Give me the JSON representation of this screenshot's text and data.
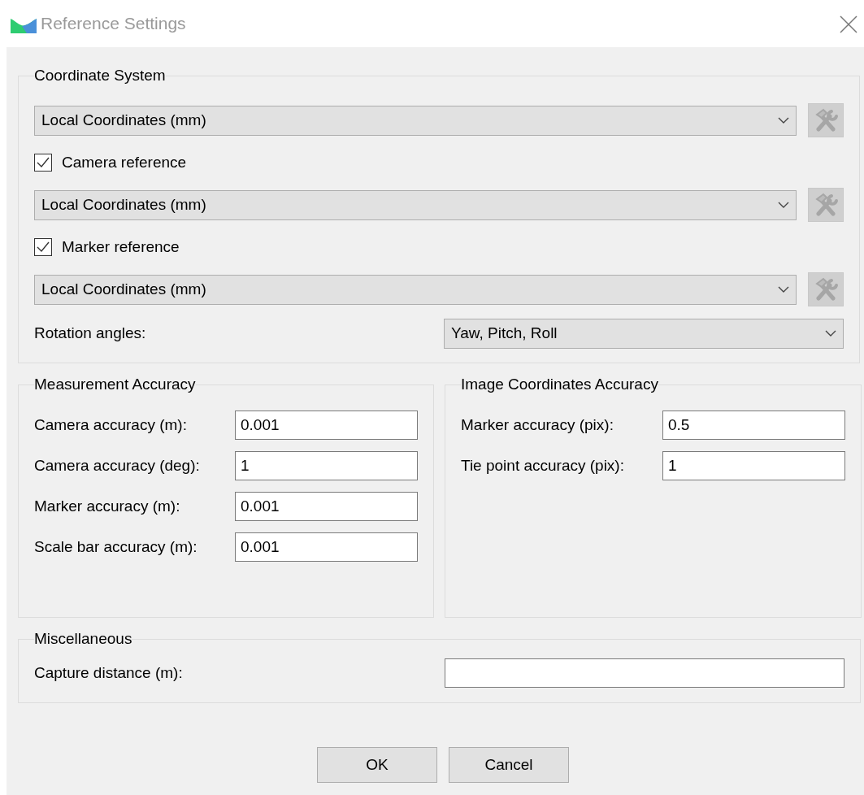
{
  "window": {
    "title": "Reference Settings"
  },
  "coordinate_system": {
    "title": "Coordinate System",
    "crs": "Local Coordinates (mm)",
    "camera_reference": {
      "label": "Camera reference",
      "checked": true,
      "crs": "Local Coordinates (mm)"
    },
    "marker_reference": {
      "label": "Marker reference",
      "checked": true,
      "crs": "Local Coordinates (mm)"
    },
    "rotation": {
      "label": "Rotation angles:",
      "value": "Yaw, Pitch, Roll"
    }
  },
  "measurement_accuracy": {
    "title": "Measurement Accuracy",
    "fields": [
      {
        "label": "Camera accuracy (m):",
        "value": "0.001"
      },
      {
        "label": "Camera accuracy (deg):",
        "value": "1"
      },
      {
        "label": "Marker accuracy (m):",
        "value": "0.001"
      },
      {
        "label": "Scale bar accuracy (m):",
        "value": "0.001"
      }
    ]
  },
  "image_coordinates_accuracy": {
    "title": "Image Coordinates Accuracy",
    "fields": [
      {
        "label": "Marker accuracy (pix):",
        "value": "0.5"
      },
      {
        "label": "Tie point accuracy (pix):",
        "value": "1"
      }
    ]
  },
  "miscellaneous": {
    "title": "Miscellaneous",
    "fields": [
      {
        "label": "Capture distance (m):"
      }
    ]
  },
  "buttons": [
    "OK",
    "Cancel"
  ]
}
